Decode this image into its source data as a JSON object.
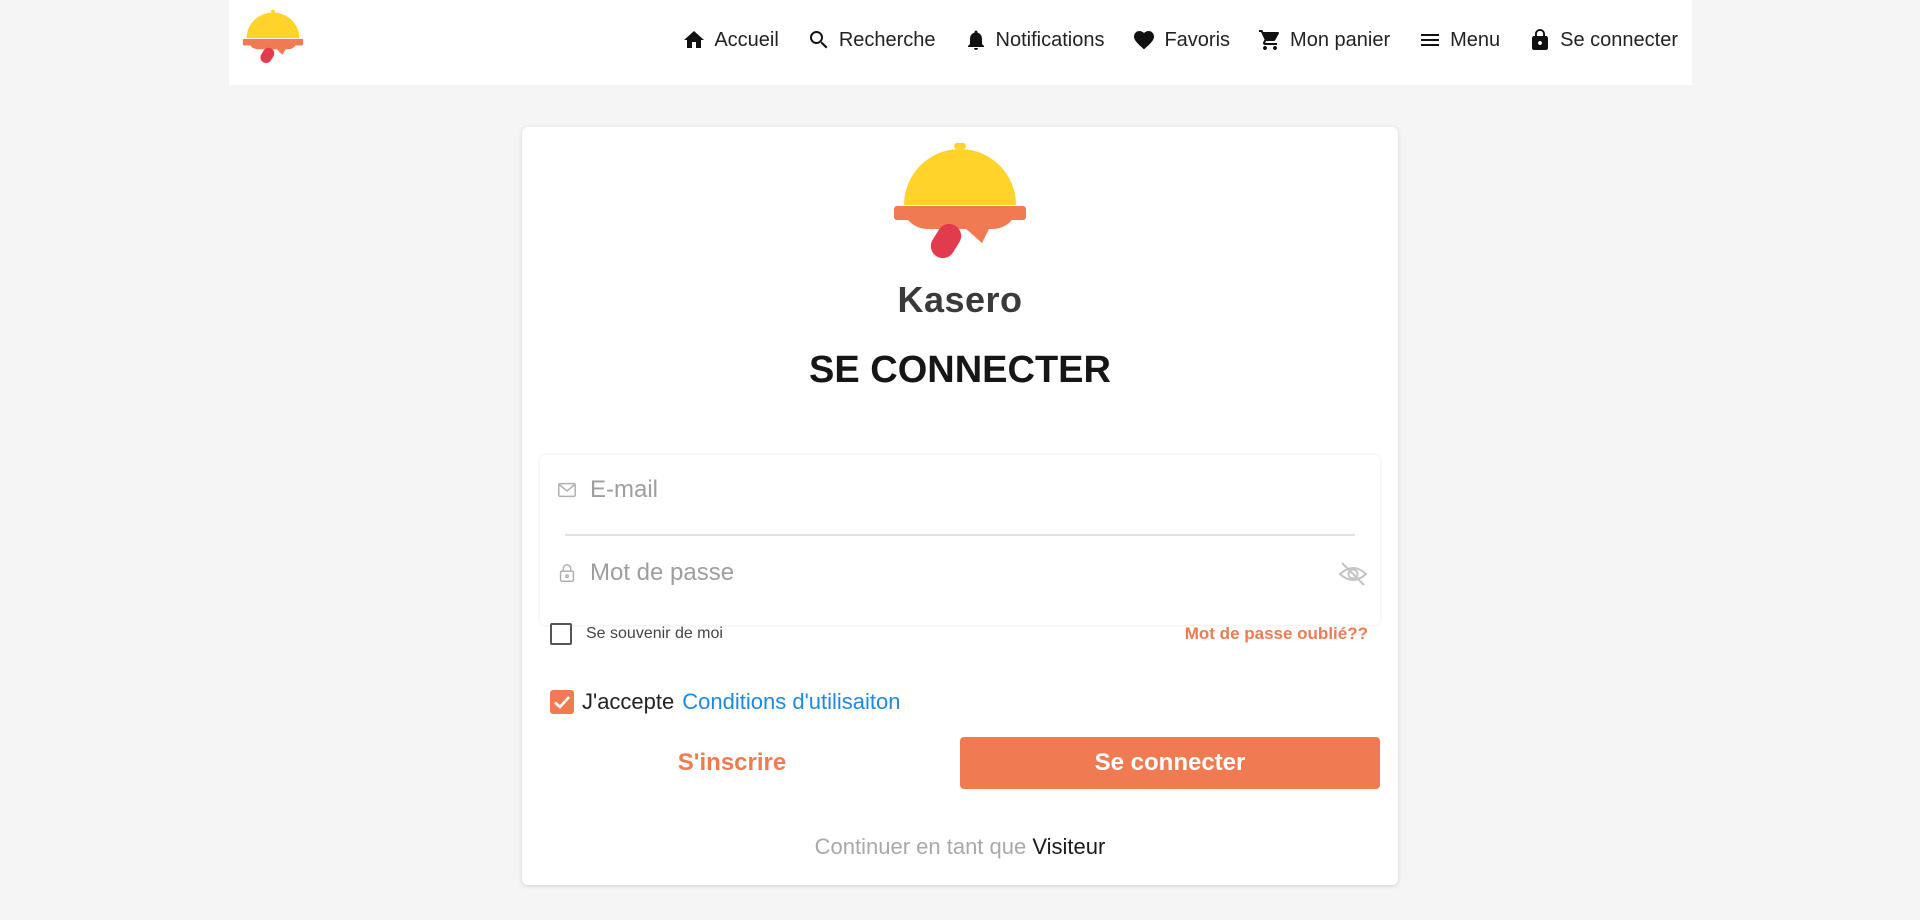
{
  "header": {
    "nav": [
      {
        "label": "Accueil",
        "icon": "home-icon"
      },
      {
        "label": "Recherche",
        "icon": "search-icon"
      },
      {
        "label": "Notifications",
        "icon": "bell-icon"
      },
      {
        "label": "Favoris",
        "icon": "heart-icon"
      },
      {
        "label": "Mon panier",
        "icon": "cart-icon"
      },
      {
        "label": "Menu",
        "icon": "menu-icon"
      },
      {
        "label": "Se connecter",
        "icon": "lock-icon"
      }
    ]
  },
  "login": {
    "brand_name": "Kasero",
    "title": "SE CONNECTER",
    "email_placeholder": "E-mail",
    "email_value": "",
    "password_placeholder": "Mot de passe",
    "password_value": "",
    "remember_label": "Se souvenir de moi",
    "remember_checked": false,
    "forgot_label": "Mot de passe oublié??",
    "terms_prefix": "J'accepte",
    "terms_link": "Conditions d'utilisaiton",
    "terms_checked": true,
    "signup_label": "S'inscrire",
    "login_label": "Se connecter",
    "guest_prefix": "Continuer en tant que",
    "guest_link": "Visiteur"
  },
  "colors": {
    "accent": "#f07b53",
    "link_blue": "#1e88e5",
    "logo_yellow": "#ffd32a",
    "logo_red": "#e23b4e"
  }
}
